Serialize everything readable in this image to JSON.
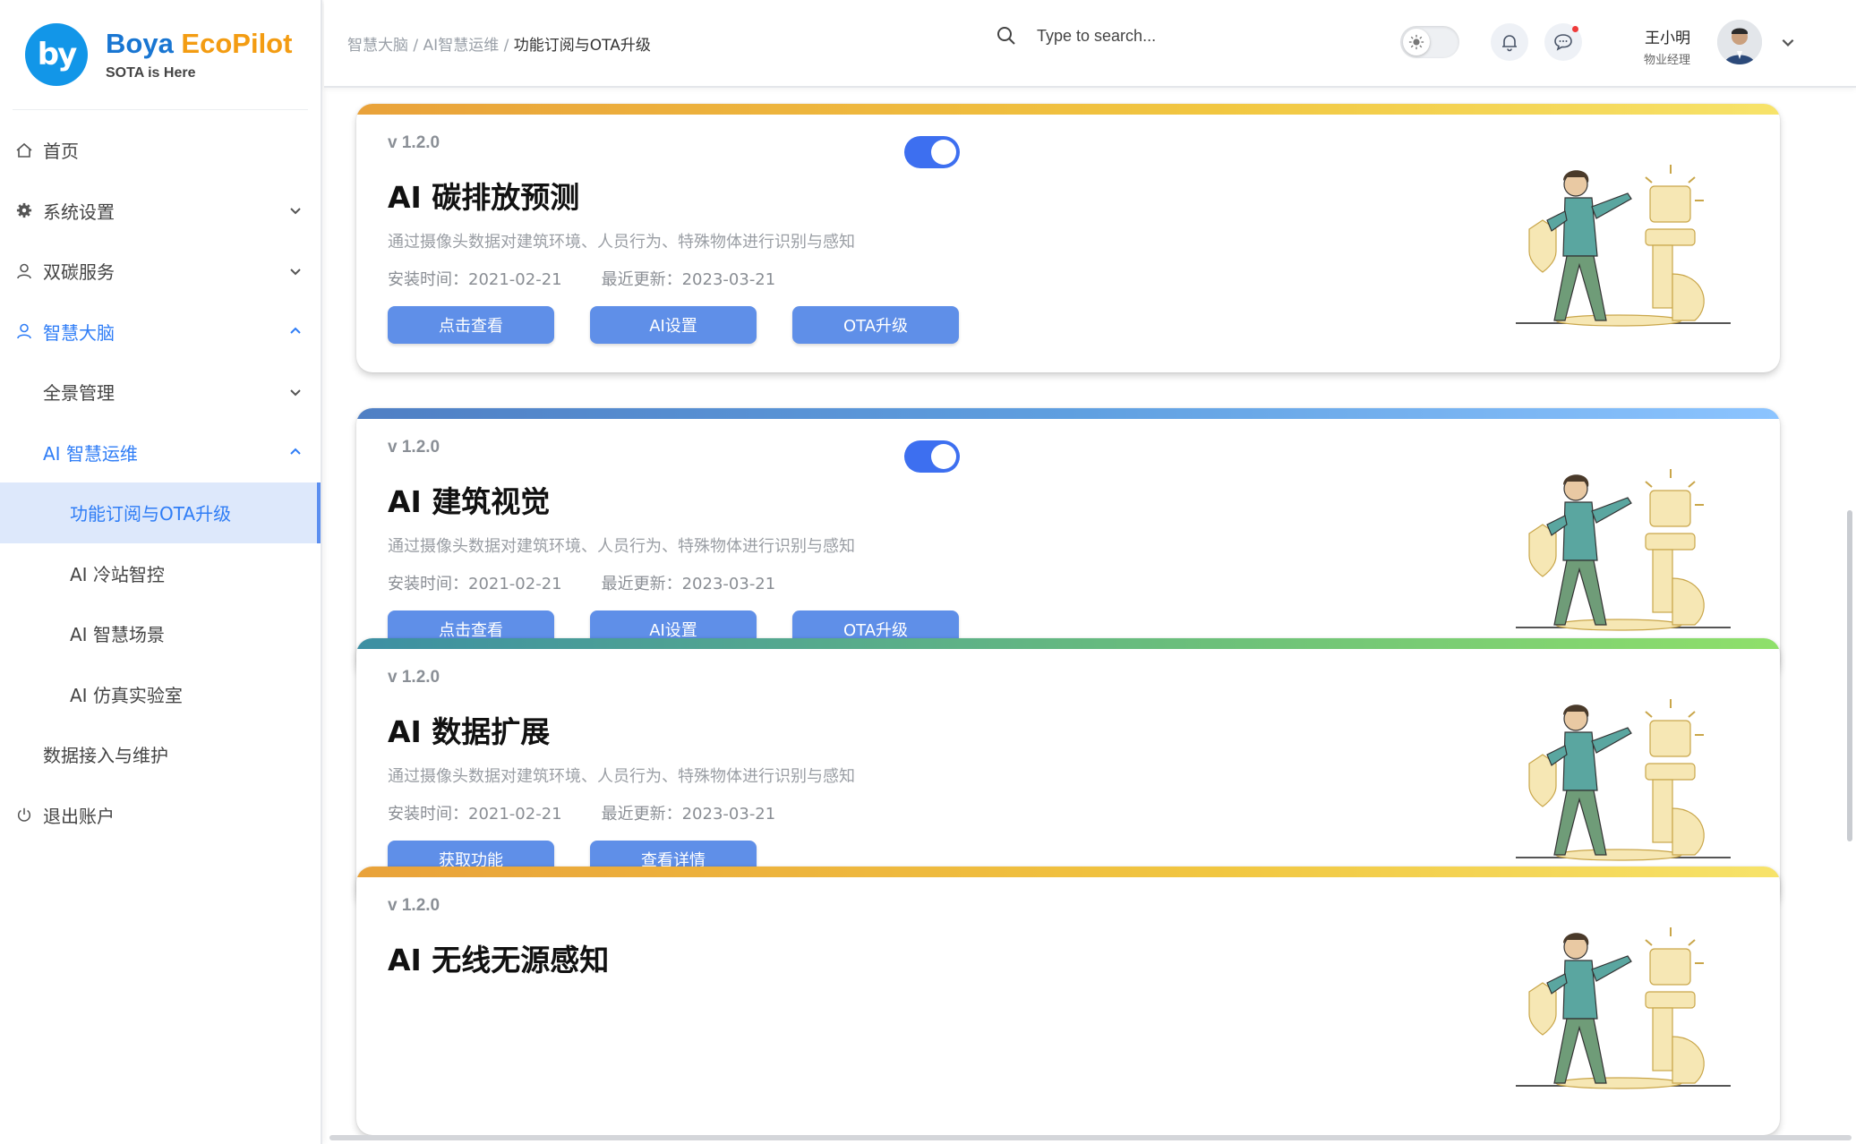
{
  "brand": {
    "name_part1": "Boya ",
    "name_part2": "EcoPilot",
    "tagline": "SOTA is Here",
    "logo_text": "by"
  },
  "sidebar": {
    "items": [
      {
        "label": "首页",
        "icon": "home-icon"
      },
      {
        "label": "系统设置",
        "icon": "gear-icon"
      },
      {
        "label": "双碳服务",
        "icon": "user-icon"
      },
      {
        "label": "智慧大脑",
        "icon": "user-icon"
      },
      {
        "label": "全景管理"
      },
      {
        "label": "AI 智慧运维"
      },
      {
        "label": "功能订阅与OTA升级"
      },
      {
        "label": "AI 冷站智控"
      },
      {
        "label": "AI 智慧场景"
      },
      {
        "label": "AI 仿真实验室"
      },
      {
        "label": "数据接入与维护"
      },
      {
        "label": "退出账户",
        "icon": "power-icon"
      }
    ]
  },
  "header": {
    "breadcrumb": [
      "智慧大脑",
      "AI智慧运维",
      "功能订阅与OTA升级"
    ],
    "breadcrumb_sep": " / ",
    "search_placeholder": "Type to search...",
    "user_name": "王小明",
    "user_role": "物业经理"
  },
  "colors": {
    "accent": "#3d6ff0",
    "button": "#5f8fe8",
    "selected_bg": "#dde8fb"
  },
  "cards": [
    {
      "version": "v 1.2.0",
      "title": "AI 碳排放预测",
      "desc": "通过摄像头数据对建筑环境、人员行为、特殊物体进行识别与感知",
      "install": "安装时间：2021-02-21",
      "update": "最近更新：2023-03-21",
      "enabled": true,
      "buttons": [
        "点击查看",
        "AI设置",
        "OTA升级"
      ],
      "bar": "orange-yellow"
    },
    {
      "version": "v 1.2.0",
      "title": "AI 建筑视觉",
      "desc": "通过摄像头数据对建筑环境、人员行为、特殊物体进行识别与感知",
      "install": "安装时间：2021-02-21",
      "update": "最近更新：2023-03-21",
      "enabled": true,
      "buttons": [
        "点击查看",
        "AI设置",
        "OTA升级"
      ],
      "bar": "blue"
    },
    {
      "version": "v 1.2.0",
      "title": "AI 数据扩展",
      "desc": "通过摄像头数据对建筑环境、人员行为、特殊物体进行识别与感知",
      "install": "安装时间：2021-02-21",
      "update": "最近更新：2023-03-21",
      "enabled": false,
      "buttons": [
        "获取功能",
        "查看详情"
      ],
      "bar": "teal-green"
    },
    {
      "version": "v 1.2.0",
      "title": "AI 无线无源感知",
      "bar": "orange-yellow"
    }
  ]
}
